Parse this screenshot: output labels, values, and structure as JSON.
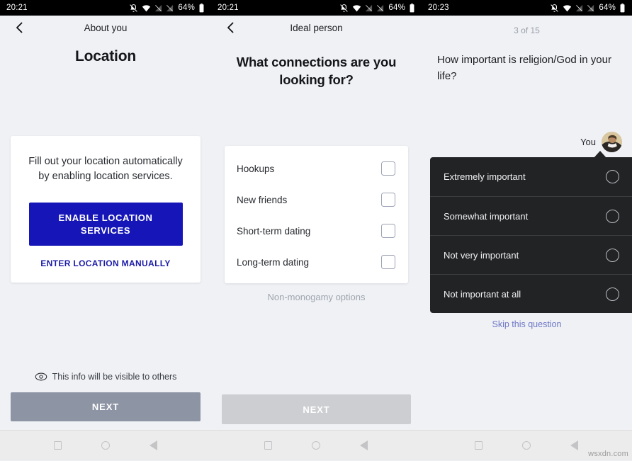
{
  "device": {
    "battery": "64%",
    "nav": {
      "recents": "recents-square",
      "home": "home-circle",
      "back": "back-triangle"
    }
  },
  "watermark": "wsxdn.com",
  "screens": [
    {
      "status_time": "20:21",
      "nav_title": "About you",
      "page_title": "Location",
      "card": {
        "description": "Fill out your location automatically by enabling location services.",
        "primary_button": "ENABLE LOCATION SERVICES",
        "secondary_button": "ENTER LOCATION MANUALLY"
      },
      "visibility_note": "This info will be visible to others",
      "next_button": "NEXT"
    },
    {
      "status_time": "20:21",
      "nav_title": "Ideal person",
      "question": "What connections are you looking for?",
      "options": [
        {
          "label": "Hookups",
          "checked": false
        },
        {
          "label": "New friends",
          "checked": false
        },
        {
          "label": "Short-term dating",
          "checked": false
        },
        {
          "label": "Long-term dating",
          "checked": false
        }
      ],
      "sub_link": "Non-monogamy options",
      "next_button": "NEXT"
    },
    {
      "status_time": "20:23",
      "progress": "3 of 15",
      "question": "How important is religion/God in your life?",
      "you_label": "You",
      "answers": [
        {
          "label": "Extremely important",
          "selected": false
        },
        {
          "label": "Somewhat important",
          "selected": false
        },
        {
          "label": "Not very important",
          "selected": false
        },
        {
          "label": "Not important at all",
          "selected": false
        }
      ],
      "skip_link": "Skip this question"
    }
  ],
  "colors": {
    "background": "#eff1f5",
    "card": "#ffffff",
    "primary_blue": "#1515b8",
    "link_blue": "#1b1ba8",
    "skip_blue": "#6f78c4",
    "next_disabled_1": "#8d94a4",
    "next_disabled_2": "#ccced1",
    "dark_panel": "#222325",
    "muted_text": "#a0a5ae"
  }
}
